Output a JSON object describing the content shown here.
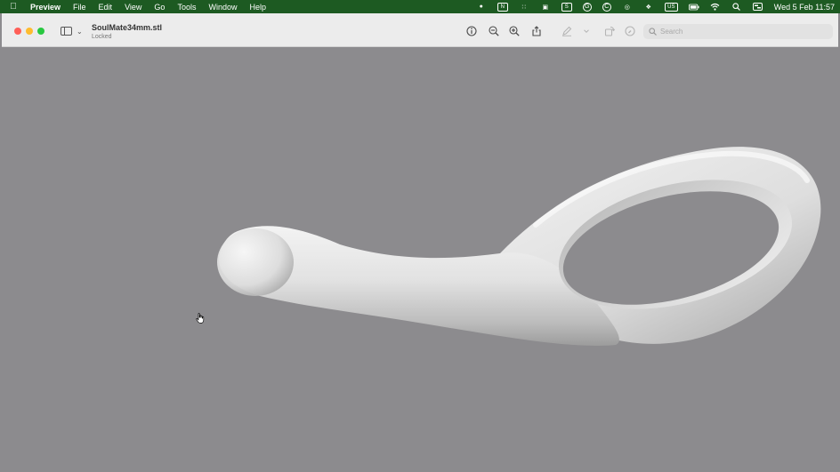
{
  "menubar": {
    "apple_icon": "apple-logo-icon",
    "menus": [
      "Preview",
      "File",
      "Edit",
      "View",
      "Go",
      "Tools",
      "Window",
      "Help"
    ],
    "status_icons": [
      "record-icon",
      "notion-icon",
      "grid-icon",
      "camera-icon",
      "s-icon",
      "g-circle-icon",
      "c-circle-icon",
      "eye-icon",
      "dropbox-icon",
      "keyboard-layout-icon",
      "battery-icon",
      "wifi-icon",
      "spotlight-search-icon",
      "control-center-icon"
    ],
    "keyboard_layout": "US",
    "clock": "Wed 5 Feb  11:57",
    "bg_color": "#1d5a22"
  },
  "window": {
    "title": "SoulMate34mm.stl",
    "subtitle": "Locked",
    "toolbar": {
      "info_icon": "info-icon",
      "zoom_out_icon": "zoom-out-icon",
      "zoom_in_icon": "zoom-in-icon",
      "share_icon": "share-icon",
      "markup_icon": "markup-pen-icon",
      "rotate_icon": "rotate-icon",
      "annotate_icon": "annotate-icon"
    },
    "search": {
      "placeholder": "Search",
      "value": ""
    }
  },
  "canvas": {
    "background": "#8c8b8e",
    "model_color": "#e6e6e6"
  }
}
